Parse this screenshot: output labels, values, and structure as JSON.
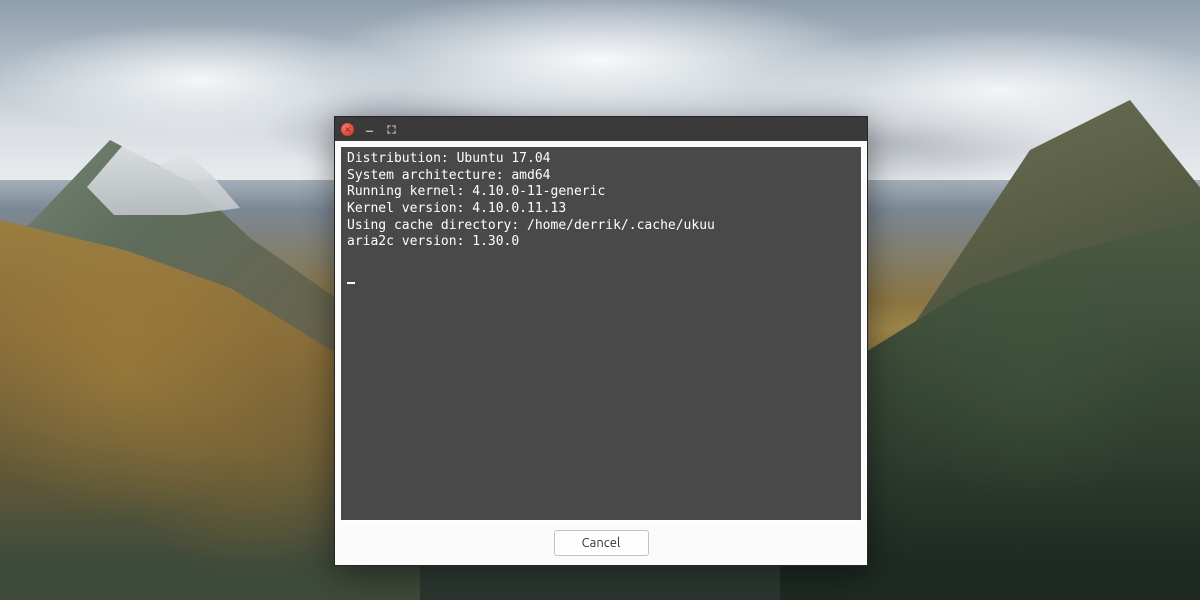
{
  "terminal": {
    "lines": [
      "Distribution: Ubuntu 17.04",
      "System architecture: amd64",
      "Running kernel: 4.10.0-11-generic",
      "Kernel version: 4.10.0.11.13",
      "Using cache directory: /home/derrik/.cache/ukuu",
      "aria2c version: 1.30.0"
    ]
  },
  "buttons": {
    "cancel": "Cancel"
  },
  "titlebar": {
    "close_tooltip": "Close",
    "minimize_tooltip": "Minimize",
    "maximize_tooltip": "Maximize"
  }
}
